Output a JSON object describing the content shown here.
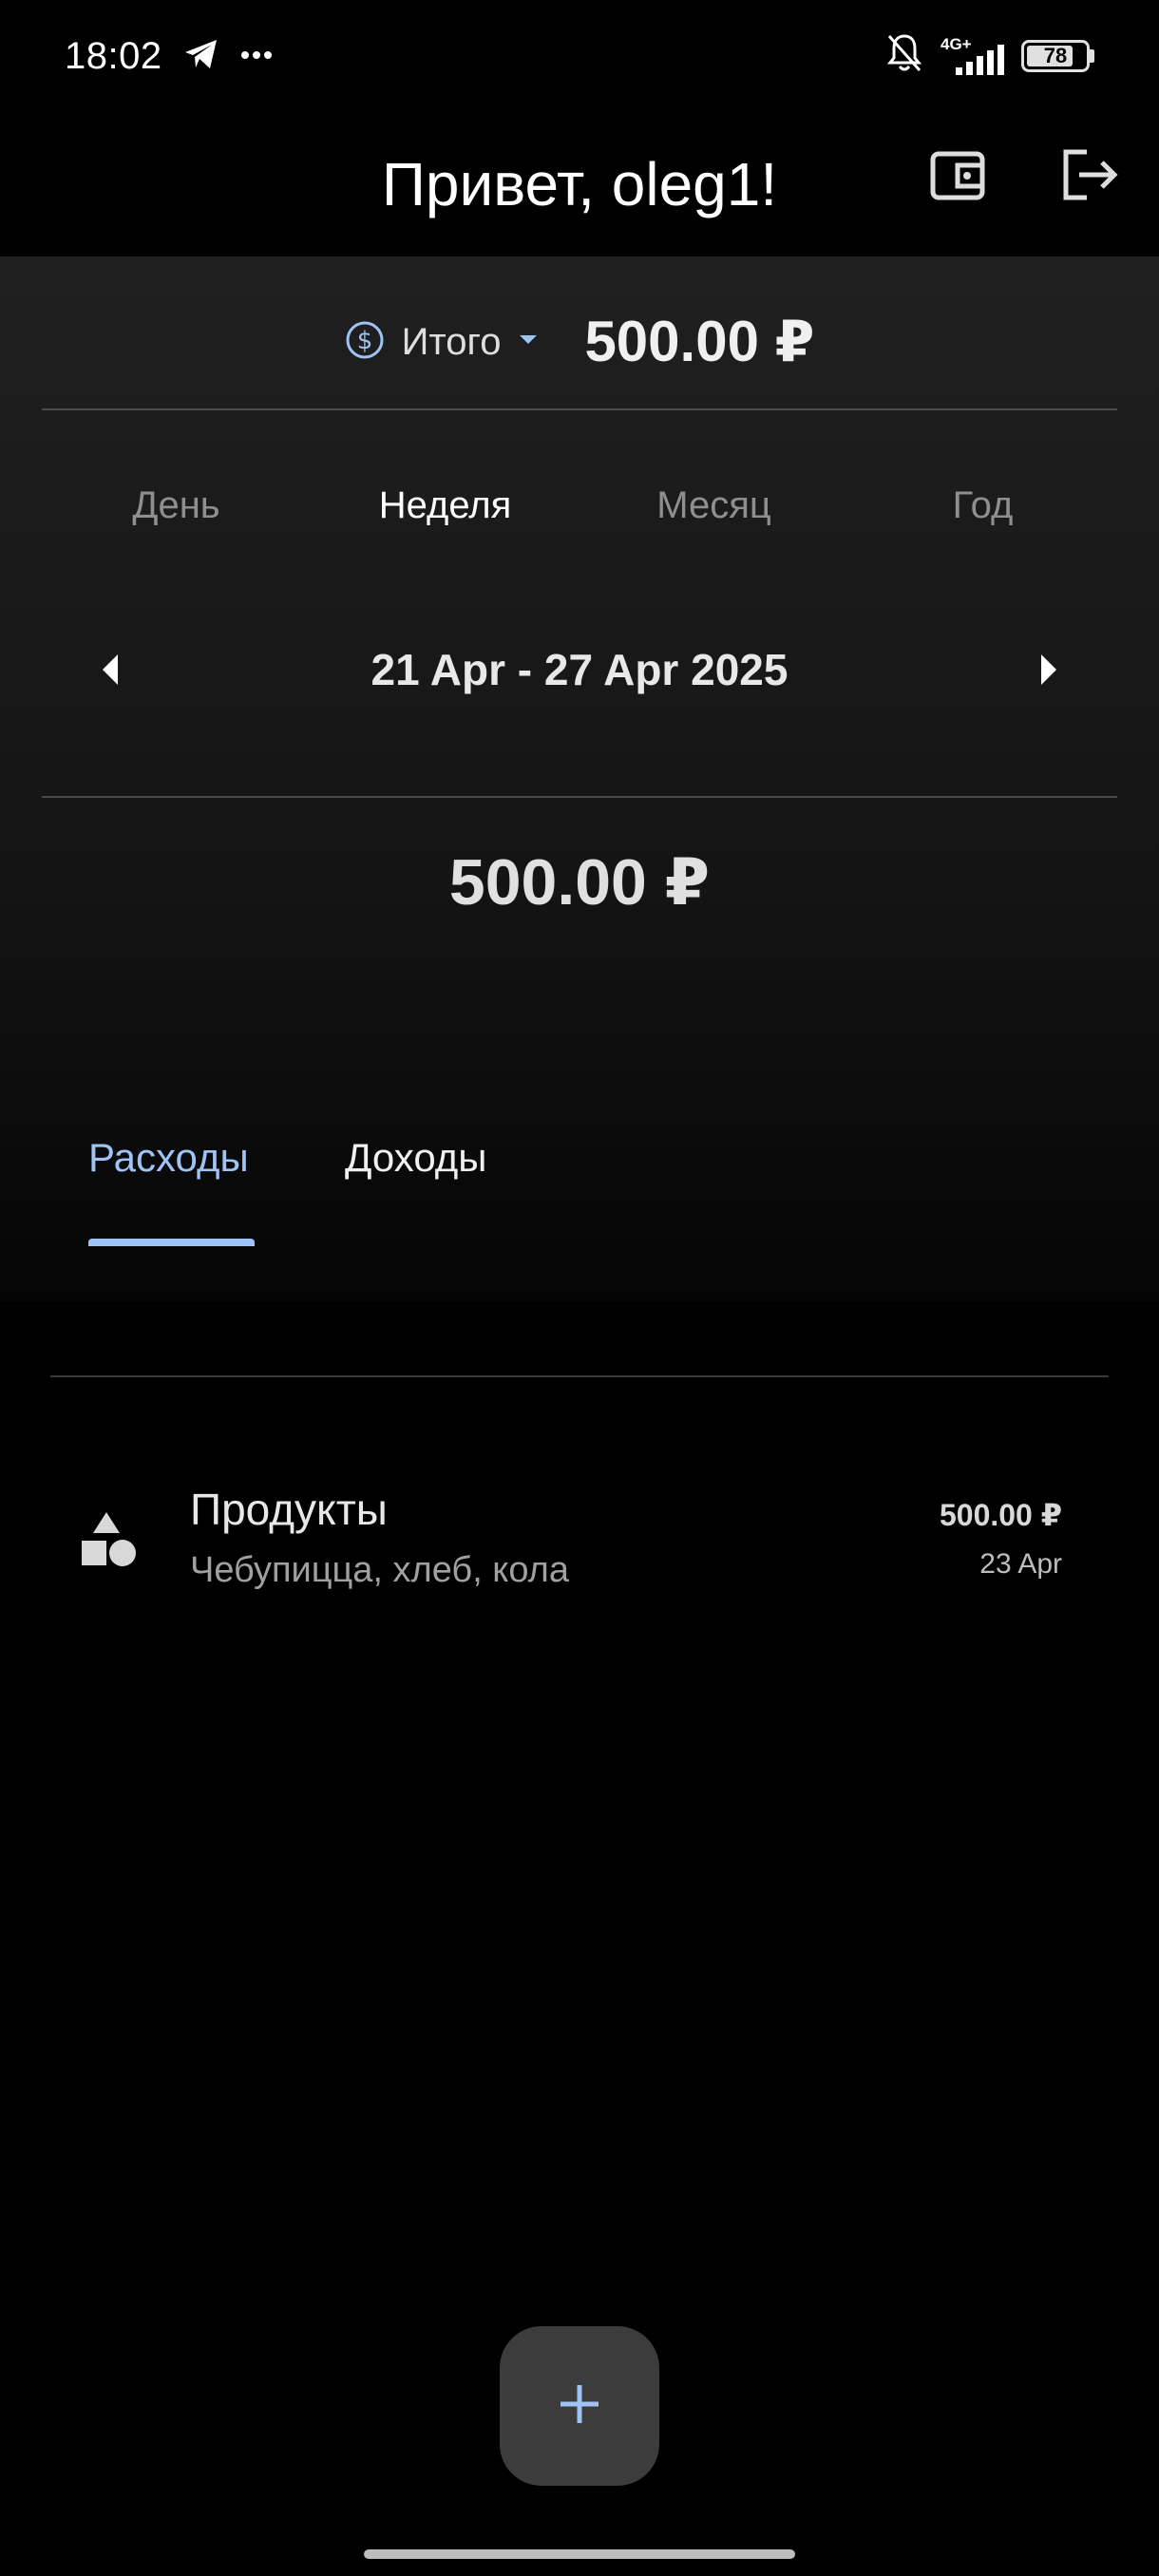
{
  "status_bar": {
    "time": "18:02",
    "network": "4G+",
    "battery": "78",
    "battery_level": 0.78,
    "icons": [
      "telegram-icon",
      "more-icon",
      "mute-bell-icon",
      "signal-icon",
      "battery-icon"
    ]
  },
  "header": {
    "greeting": "Привет, oleg1!",
    "actions": [
      "wallet-icon",
      "logout-icon"
    ]
  },
  "summary": {
    "account_label": "Итого",
    "account_total": "500.00 ₽",
    "periods": [
      "День",
      "Неделя",
      "Месяц",
      "Год"
    ],
    "active_period": "Неделя",
    "date_range": "21 Apr - 27 Apr 2025",
    "period_total": "500.00 ₽"
  },
  "tabs": {
    "expenses": "Расходы",
    "income": "Доходы",
    "active": "Расходы"
  },
  "transactions": [
    {
      "category": "Продукты",
      "note": "Чебупицца, хлеб, кола",
      "amount": "500.00 ₽",
      "date": "23 Apr",
      "icon": "category-shapes-icon"
    }
  ],
  "colors": {
    "accent": "#9ec4f5",
    "background": "#000000",
    "card": "#202020",
    "fab": "#3c3c3c"
  }
}
